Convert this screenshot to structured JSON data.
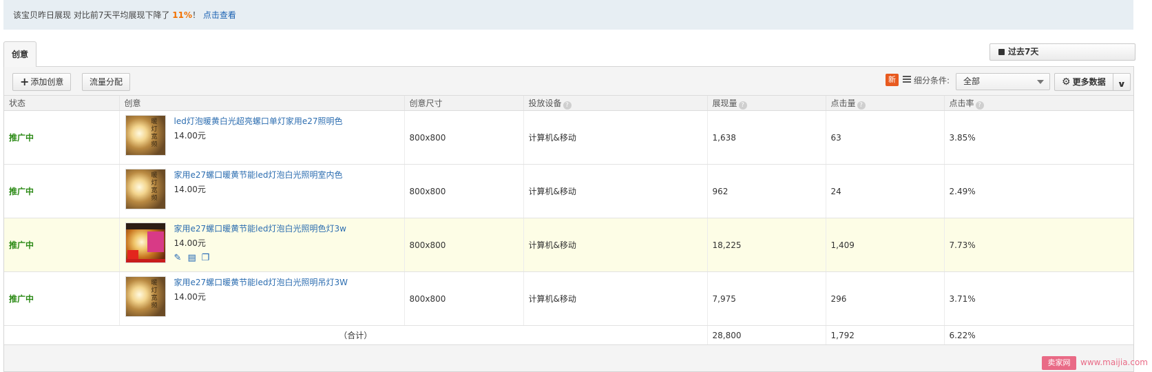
{
  "notice": {
    "prefix": "该宝贝昨日展现 对比前7天平均展现下降了 ",
    "percent": "11%",
    "suffix": "！",
    "link": "点击查看"
  },
  "tabs": {
    "active": "创意"
  },
  "date_range": "过去7天",
  "toolbar": {
    "add_creative": "添加创意",
    "traffic_allocation": "流量分配",
    "new_badge": "新",
    "filter_label": "细分条件:",
    "filter_value": "全部",
    "more_data": "更多数据"
  },
  "table": {
    "headers": [
      "状态",
      "创意",
      "创意尺寸",
      "投放设备",
      "展现量",
      "点击量",
      "点击率"
    ],
    "rows": [
      {
        "status": "推广中",
        "title": "led灯泡暖黄白光超亮螺口单灯家用e27照明色",
        "price": "14.00元",
        "size": "800x800",
        "device": "计算机&移动",
        "impressions": "1,638",
        "clicks": "63",
        "ctr": "3.85%",
        "thumb_text": "暖灯 宽频"
      },
      {
        "status": "推广中",
        "title": "家用e27螺口暖黄节能led灯泡白光照明室内色",
        "price": "14.00元",
        "size": "800x800",
        "device": "计算机&移动",
        "impressions": "962",
        "clicks": "24",
        "ctr": "2.49%",
        "thumb_text": "暖灯 宽频"
      },
      {
        "status": "推广中",
        "title": "家用e27螺口暖黄节能led灯泡白光照明色灯3w",
        "price": "14.00元",
        "size": "800x800",
        "device": "计算机&移动",
        "impressions": "18,225",
        "clicks": "1,409",
        "ctr": "7.73%",
        "highlighted": true
      },
      {
        "status": "推广中",
        "title": "家用e27螺口暖黄节能led灯泡白光照明吊灯3W",
        "price": "14.00元",
        "size": "800x800",
        "device": "计算机&移动",
        "impressions": "7,975",
        "clicks": "296",
        "ctr": "3.71%",
        "thumb_text": "暖灯 宽频"
      }
    ],
    "total": {
      "label": "（合计）",
      "impressions": "28,800",
      "clicks": "1,792",
      "ctr": "6.22%"
    }
  },
  "watermark": {
    "logo": "卖家网",
    "url": "www.maijia.com"
  },
  "colors": {
    "status_green": "#2c8a16",
    "link_blue": "#2c6db0",
    "accent_orange": "#f27100",
    "highlight_row": "#fdfde6"
  }
}
